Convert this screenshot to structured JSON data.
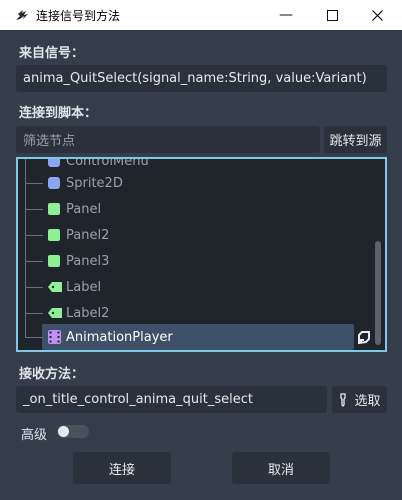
{
  "window": {
    "title": "连接信号到方法",
    "minimize_glyph": "—",
    "maximize_glyph": "☐",
    "close_glyph": "✕"
  },
  "signal_section": {
    "label": "来自信号：",
    "value": "anima_QuitSelect(signal_name:String, value:Variant)"
  },
  "script_section": {
    "label": "连接到脚本：",
    "filter_placeholder": "筛选节点",
    "jump_button": "跳转到源"
  },
  "tree": {
    "partial_top": "ControlMenu",
    "nodes": [
      {
        "label": "Sprite2D",
        "icon": "sprite2d-icon",
        "color": "#8da5f3"
      },
      {
        "label": "Panel",
        "icon": "panel-icon",
        "color": "#8eef97"
      },
      {
        "label": "Panel2",
        "icon": "panel-icon",
        "color": "#8eef97"
      },
      {
        "label": "Panel3",
        "icon": "panel-icon",
        "color": "#8eef97"
      },
      {
        "label": "Label",
        "icon": "label-icon",
        "color": "#8eef97"
      },
      {
        "label": "Label2",
        "icon": "label-icon",
        "color": "#8eef97"
      },
      {
        "label": "AnimationPlayer",
        "icon": "animation-player-icon",
        "color": "#c38ef1",
        "selected": true
      }
    ]
  },
  "method_section": {
    "label": "接收方法：",
    "value": "_on_title_control_anima_quit_select",
    "pick_button": "选取"
  },
  "advanced": {
    "label": "高级",
    "enabled": false
  },
  "footer": {
    "connect_button": "连接",
    "cancel_button": "取消"
  },
  "colors": {
    "accent": "#7fc8e8",
    "background": "#363d4a",
    "field": "#2b313b",
    "selection": "#3e5068"
  }
}
